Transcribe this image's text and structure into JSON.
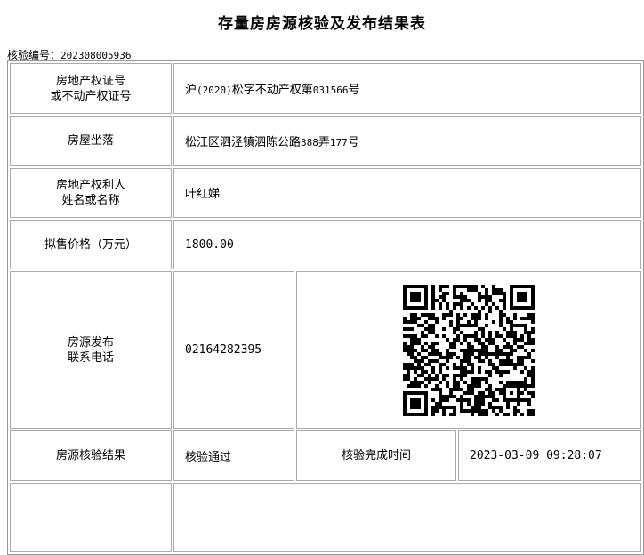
{
  "page_title": "存量房房源核验及发布结果表",
  "verification": {
    "label": "核验编号：",
    "number": "202308005936"
  },
  "rows": {
    "certificate": {
      "label_line1": "房地产权证号",
      "label_line2": "或不动产权证号",
      "value_prefix": "沪",
      "value_year": "(2020)",
      "value_mid": "松字不动产权第",
      "value_num": "031566",
      "value_suffix": "号"
    },
    "address": {
      "label": "房屋坐落",
      "value_prefix": "松江区泗泾镇泗陈公路",
      "value_num": "388",
      "value_mid": "弄",
      "value_num2": "177",
      "value_suffix": "号"
    },
    "owner": {
      "label_line1": "房地产权利人",
      "label_line2": "姓名或名称",
      "value": "叶红娣"
    },
    "price": {
      "label": "拟售价格（万元）",
      "value": "1800.00"
    },
    "contact": {
      "label_line1": "房源发布",
      "label_line2": "联系电话",
      "value": "02164282395",
      "qr_icon": "qr-code-icon"
    },
    "result": {
      "label": "房源核验结果",
      "value": "核验通过",
      "time_label": "核验完成时间",
      "time_value": "2023-03-09 09:28:07"
    }
  },
  "colors": {
    "border": "#aaaaaa",
    "text": "#000000",
    "background": "#ffffff"
  }
}
